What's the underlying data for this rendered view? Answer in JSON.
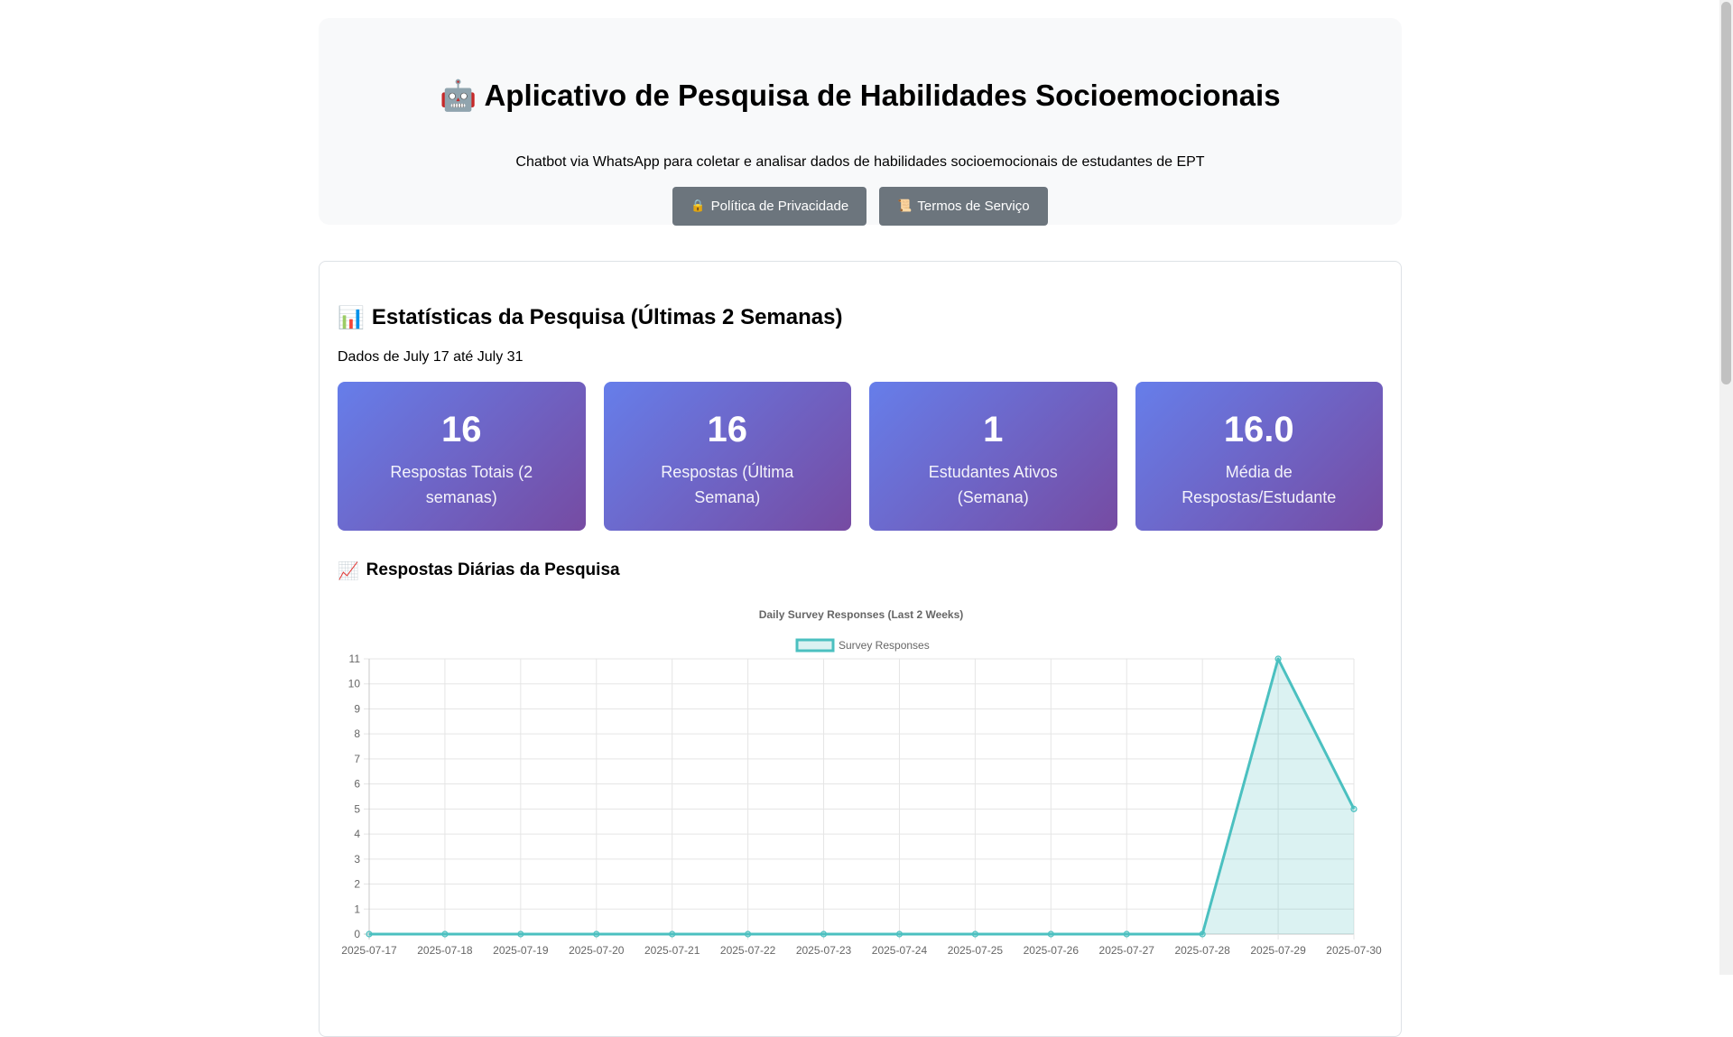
{
  "header": {
    "icon": "robot-icon",
    "icon_glyph": "🤖",
    "title": "Aplicativo de Pesquisa de Habilidades Socioemocionais",
    "subtitle": "Chatbot via WhatsApp para coletar e analisar dados de habilidades socioemocionais de estudantes de EPT",
    "buttons": {
      "privacy": {
        "icon": "lock-icon",
        "glyph": "🔒",
        "label": "Política de Privacidade"
      },
      "terms": {
        "icon": "scroll-icon",
        "glyph": "📜",
        "label": "Termos de Serviço"
      }
    }
  },
  "stats": {
    "icon": "bar-chart-icon",
    "icon_glyph": "📊",
    "title": "Estatísticas da Pesquisa (Últimas 2 Semanas)",
    "date_range": "Dados de July 17 até July 31",
    "kpis": [
      {
        "value": "16",
        "label": "Respostas Totais (2 semanas)"
      },
      {
        "value": "16",
        "label": "Respostas (Última Semana)"
      },
      {
        "value": "1",
        "label": "Estudantes Ativos (Semana)"
      },
      {
        "value": "16.0",
        "label": "Média de Respostas/Estudante"
      }
    ],
    "chart_heading": "Respostas Diárias da Pesquisa",
    "chart_heading_icon": "line-chart-icon",
    "chart_heading_glyph": "📈"
  },
  "colors": {
    "kpi_gradient_start": "#667eea",
    "kpi_gradient_end": "#764ba2",
    "line": "#4bc0c0",
    "fill": "rgba(75,192,192,0.2)",
    "button": "#6c757d"
  },
  "chart_data": {
    "type": "line",
    "title": "Daily Survey Responses (Last 2 Weeks)",
    "legend_position": "top",
    "grid": true,
    "filled": true,
    "series": [
      {
        "name": "Survey Responses",
        "values": [
          0,
          0,
          0,
          0,
          0,
          0,
          0,
          0,
          0,
          0,
          0,
          0,
          11,
          5
        ]
      }
    ],
    "categories": [
      "2025-07-17",
      "2025-07-18",
      "2025-07-19",
      "2025-07-20",
      "2025-07-21",
      "2025-07-22",
      "2025-07-23",
      "2025-07-24",
      "2025-07-25",
      "2025-07-26",
      "2025-07-27",
      "2025-07-28",
      "2025-07-29",
      "2025-07-30"
    ],
    "ylim": [
      0,
      11
    ],
    "yticks": [
      0,
      1,
      2,
      3,
      4,
      5,
      6,
      7,
      8,
      9,
      10,
      11
    ],
    "xlabel": "",
    "ylabel": ""
  }
}
